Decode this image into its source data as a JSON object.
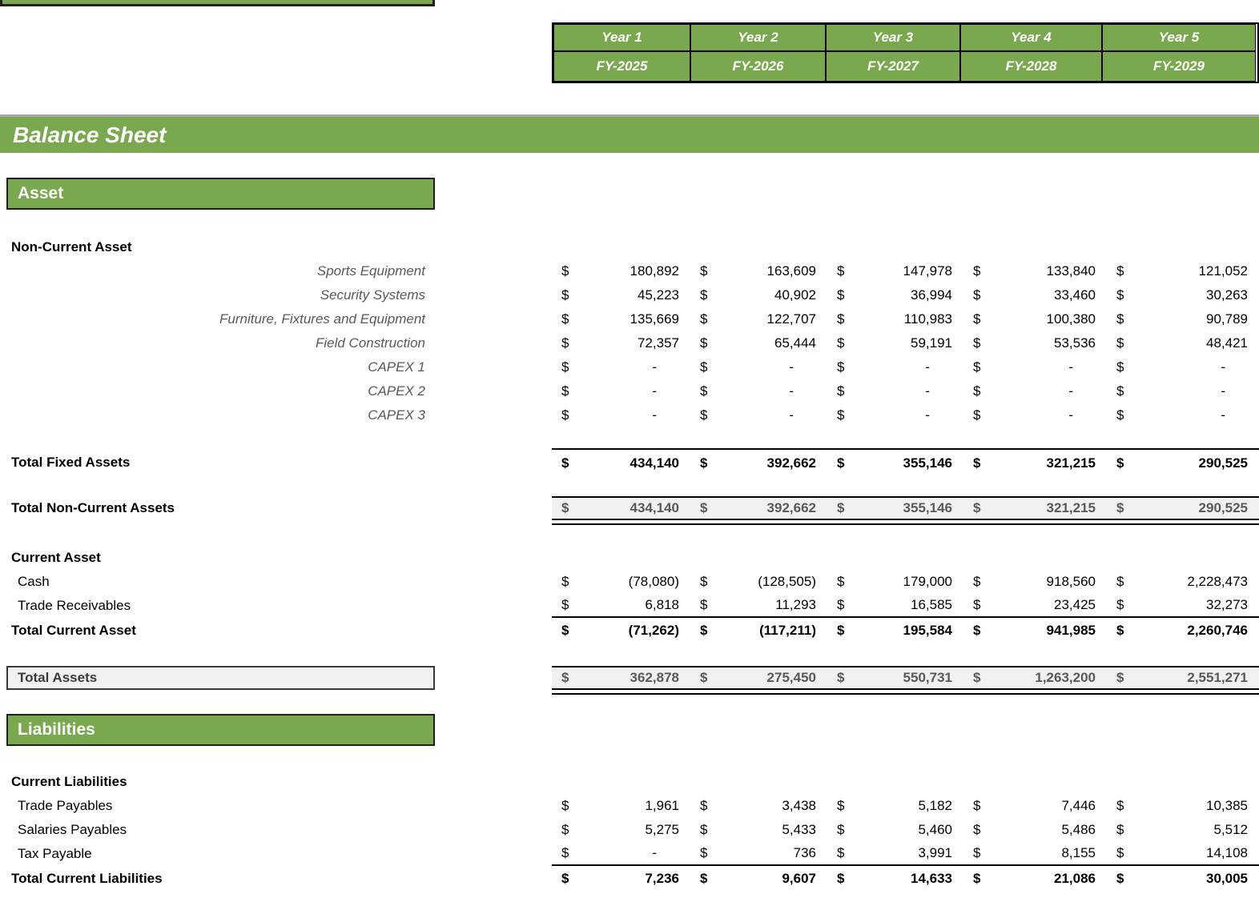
{
  "colors": {
    "green": "#79A84E",
    "band_gray": "#F1F1F1",
    "line_gray": "#A6A6A6",
    "border_dark": "#1F1F1F",
    "text_gray": "#595959"
  },
  "title_bar": {
    "label": "Balance Sheet"
  },
  "year_header": {
    "years": [
      "Year 1",
      "Year 2",
      "Year 3",
      "Year 4",
      "Year 5"
    ],
    "fiscal_years": [
      "FY-2025",
      "FY-2026",
      "FY-2027",
      "FY-2028",
      "FY-2029"
    ]
  },
  "asset_header": {
    "label": "Asset"
  },
  "currency_symbol": "$",
  "rows": [
    {
      "type": "subheader",
      "label": "Non-Current Asset"
    },
    {
      "type": "item_italic",
      "label": "Sports Equipment",
      "values": [
        "180,892",
        "163,609",
        "147,978",
        "133,840",
        "121,052"
      ]
    },
    {
      "type": "item_italic",
      "label": "Security Systems",
      "values": [
        "45,223",
        "40,902",
        "36,994",
        "33,460",
        "30,263"
      ]
    },
    {
      "type": "item_italic",
      "label": "Furniture, Fixtures and Equipment",
      "values": [
        "135,669",
        "122,707",
        "110,983",
        "100,380",
        "90,789"
      ]
    },
    {
      "type": "item_italic",
      "label": "Field Construction",
      "values": [
        "72,357",
        "65,444",
        "59,191",
        "53,536",
        "48,421"
      ]
    },
    {
      "type": "item_italic",
      "label": "CAPEX 1",
      "values": [
        "-",
        "-",
        "-",
        "-",
        "-"
      ]
    },
    {
      "type": "item_italic",
      "label": "CAPEX 2",
      "values": [
        "-",
        "-",
        "-",
        "-",
        "-"
      ]
    },
    {
      "type": "item_italic",
      "label": "CAPEX 3",
      "values": [
        "-",
        "-",
        "-",
        "-",
        "-"
      ]
    },
    {
      "type": "total_topline",
      "label": "Total Fixed Assets",
      "values": [
        "434,140",
        "392,662",
        "355,146",
        "321,215",
        "290,525"
      ]
    },
    {
      "type": "total_band",
      "label": "Total Non-Current Assets",
      "values": [
        "434,140",
        "392,662",
        "355,146",
        "321,215",
        "290,525"
      ]
    },
    {
      "type": "subheader",
      "label": "Current Asset"
    },
    {
      "type": "item_plain",
      "label": "Cash",
      "values": [
        "(78,080)",
        "(128,505)",
        "179,000",
        "918,560",
        "2,228,473"
      ]
    },
    {
      "type": "item_plain_underline",
      "label": "Trade Receivables",
      "values": [
        "6,818",
        "11,293",
        "16,585",
        "23,425",
        "32,273"
      ]
    },
    {
      "type": "total",
      "label": "Total Current Asset",
      "values": [
        "(71,262)",
        "(117,211)",
        "195,584",
        "941,985",
        "2,260,746"
      ]
    },
    {
      "type": "grand_band",
      "label": "Total Assets",
      "values": [
        "362,878",
        "275,450",
        "550,731",
        "1,263,200",
        "2,551,271"
      ]
    },
    {
      "type": "section_green",
      "label": "Liabilities"
    },
    {
      "type": "subheader",
      "label": "Current Liabilities"
    },
    {
      "type": "item_plain",
      "label": "Trade Payables",
      "values": [
        "1,961",
        "3,438",
        "5,182",
        "7,446",
        "10,385"
      ]
    },
    {
      "type": "item_plain",
      "label": "Salaries Payables",
      "values": [
        "5,275",
        "5,433",
        "5,460",
        "5,486",
        "5,512"
      ]
    },
    {
      "type": "item_plain_underline",
      "label": "Tax Payable",
      "values": [
        "-",
        "736",
        "3,991",
        "8,155",
        "14,108"
      ]
    },
    {
      "type": "total",
      "label": "Total Current Liabilities",
      "values": [
        "7,236",
        "9,607",
        "14,633",
        "21,086",
        "30,005"
      ]
    }
  ]
}
